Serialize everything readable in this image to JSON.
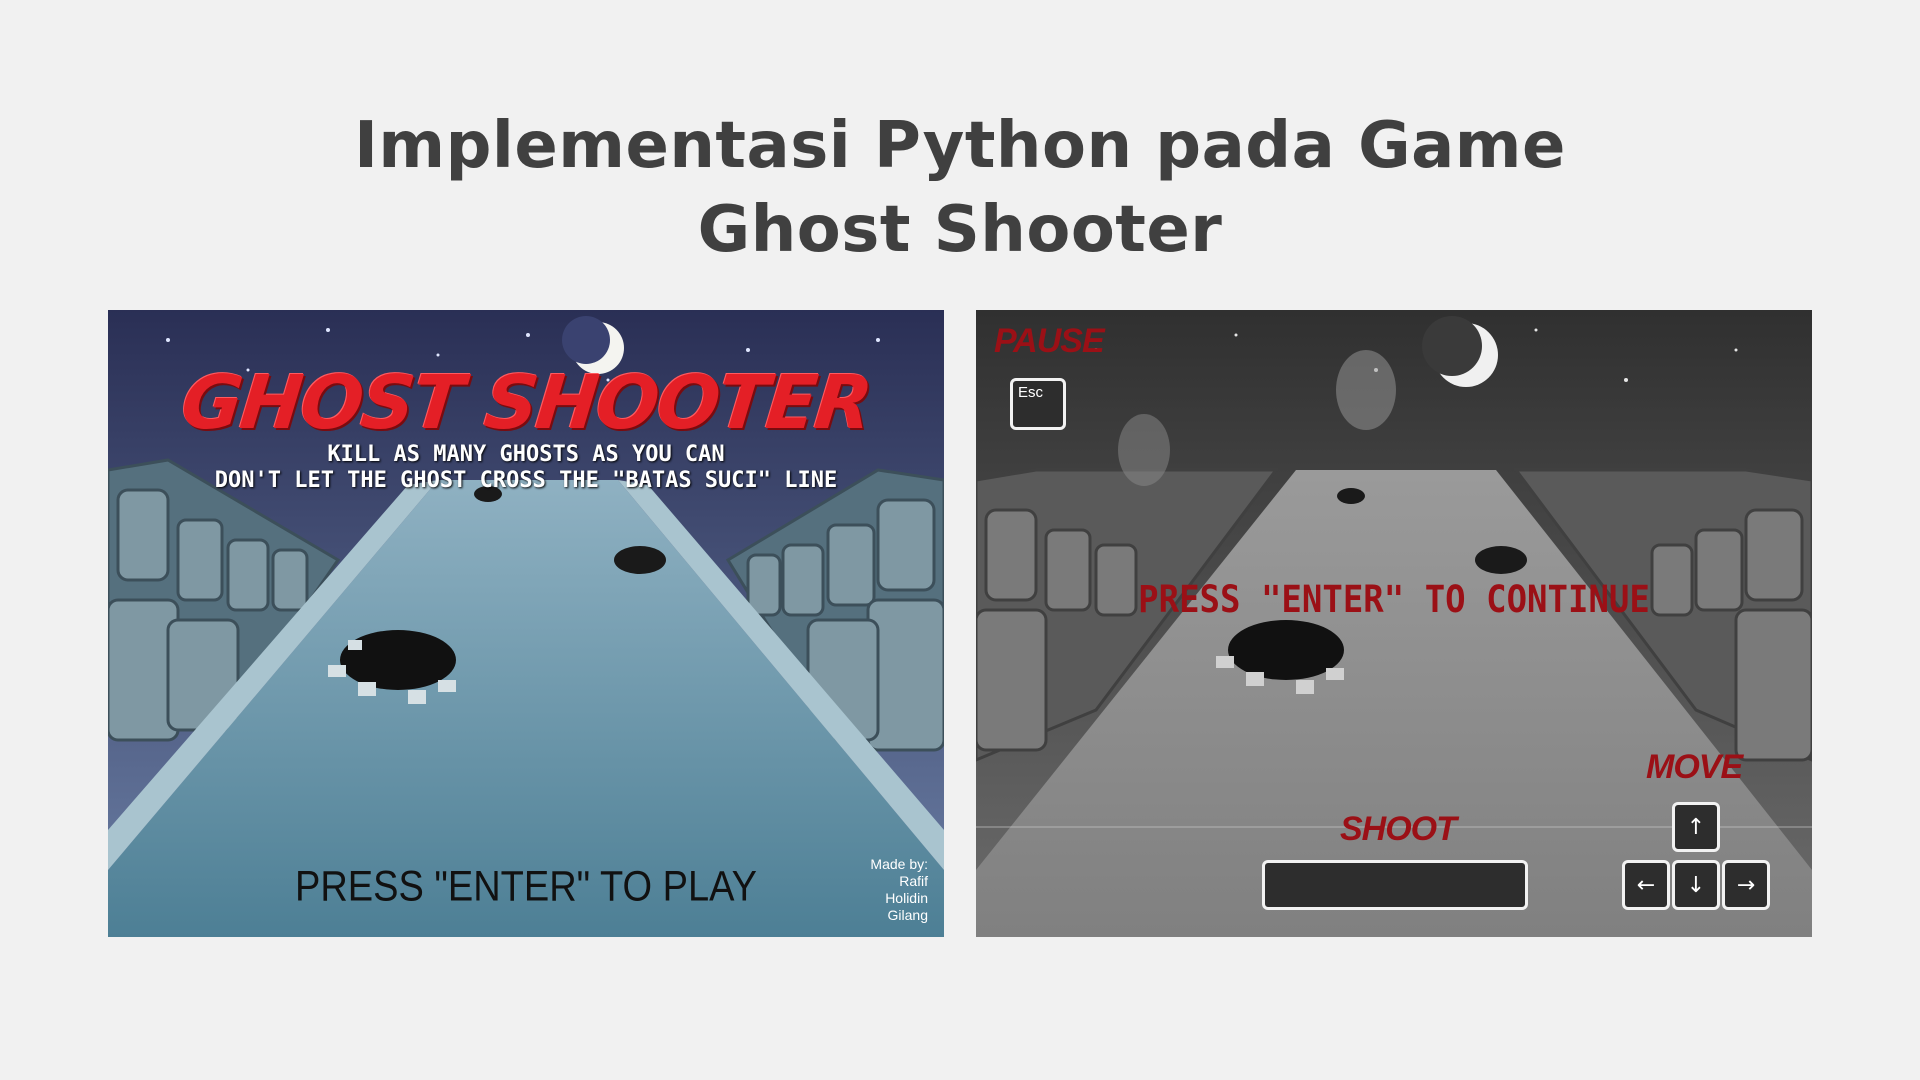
{
  "page": {
    "title": "Implementasi Python pada Game Ghost Shooter"
  },
  "menu_screen": {
    "game_title": "GHOST SHOOTER",
    "subtitle_line1": "KILL AS MANY GHOSTS AS YOU CAN",
    "subtitle_line2": "DON'T LET THE GHOST CROSS THE \"BATAS SUCI\" LINE",
    "press_prompt": "PRESS  \"ENTER\"  TO PLAY",
    "credits": {
      "heading": "Made by:",
      "names": [
        "Rafif",
        "Holidin",
        "Gilang"
      ]
    }
  },
  "pause_screen": {
    "pause_label": "PAUSE",
    "esc_key": "Esc",
    "continue_prompt": "PRESS \"ENTER\" TO CONTINUE",
    "shoot_label": "SHOOT",
    "move_label": "MOVE",
    "arrow_keys": {
      "up": "↑",
      "left": "←",
      "down": "↓",
      "right": "→"
    }
  },
  "colors": {
    "background": "#f1f1f1",
    "title_text": "#404040",
    "game_title_red": "#e41f26",
    "pause_red": "#9b1016"
  }
}
